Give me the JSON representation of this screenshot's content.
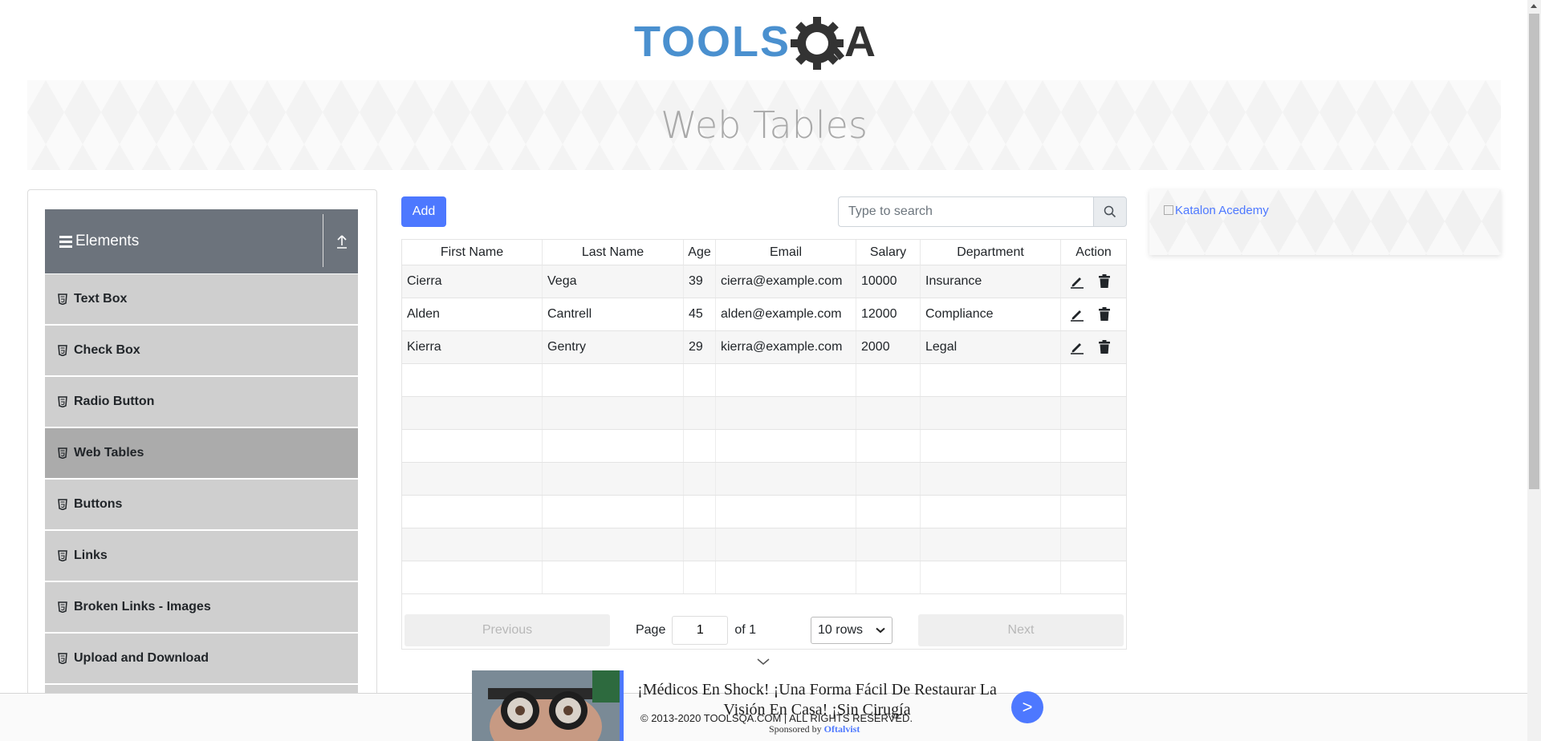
{
  "logo": {
    "text_left": "TOOLS",
    "text_right": "A"
  },
  "banner": {
    "title": "Web Tables"
  },
  "sidebar": {
    "group_title": "Elements",
    "items": [
      {
        "label": "Text Box",
        "active": false
      },
      {
        "label": "Check Box",
        "active": false
      },
      {
        "label": "Radio Button",
        "active": false
      },
      {
        "label": "Web Tables",
        "active": true
      },
      {
        "label": "Buttons",
        "active": false
      },
      {
        "label": "Links",
        "active": false
      },
      {
        "label": "Broken Links - Images",
        "active": false
      },
      {
        "label": "Upload and Download",
        "active": false
      }
    ]
  },
  "toolbar": {
    "add_label": "Add",
    "search_placeholder": "Type to search"
  },
  "table": {
    "headers": [
      "First Name",
      "Last Name",
      "Age",
      "Email",
      "Salary",
      "Department",
      "Action"
    ],
    "rows": [
      [
        "Cierra",
        "Vega",
        "39",
        "cierra@example.com",
        "10000",
        "Insurance"
      ],
      [
        "Alden",
        "Cantrell",
        "45",
        "alden@example.com",
        "12000",
        "Compliance"
      ],
      [
        "Kierra",
        "Gentry",
        "29",
        "kierra@example.com",
        "2000",
        "Legal"
      ]
    ],
    "total_rows": 10
  },
  "pagination": {
    "previous_label": "Previous",
    "page_label": "Page",
    "page_value": "1",
    "of_label": "of 1",
    "rows_option": "10 rows",
    "next_label": "Next"
  },
  "right_ad": {
    "alt_text": "Katalon Acedemy"
  },
  "bottom_ad": {
    "headline": "¡Médicos En Shock! ¡Una Forma Fácil De Restaurar La Visión En Casa! ¡Sin Cirugía",
    "button": ">",
    "sponsored_prefix": "Sponsored by ",
    "sponsor": "Oftalvist"
  },
  "footer": {
    "copyright": "© 2013-2020 TOOLSQA.COM | ALL RIGHTS RESERVED."
  },
  "colors": {
    "accent": "#4d78ff",
    "sidebar_header": "#6c737c",
    "menu_item": "#cfcfcf",
    "menu_item_active": "#ababab",
    "logo_blue": "#4a90cf"
  }
}
